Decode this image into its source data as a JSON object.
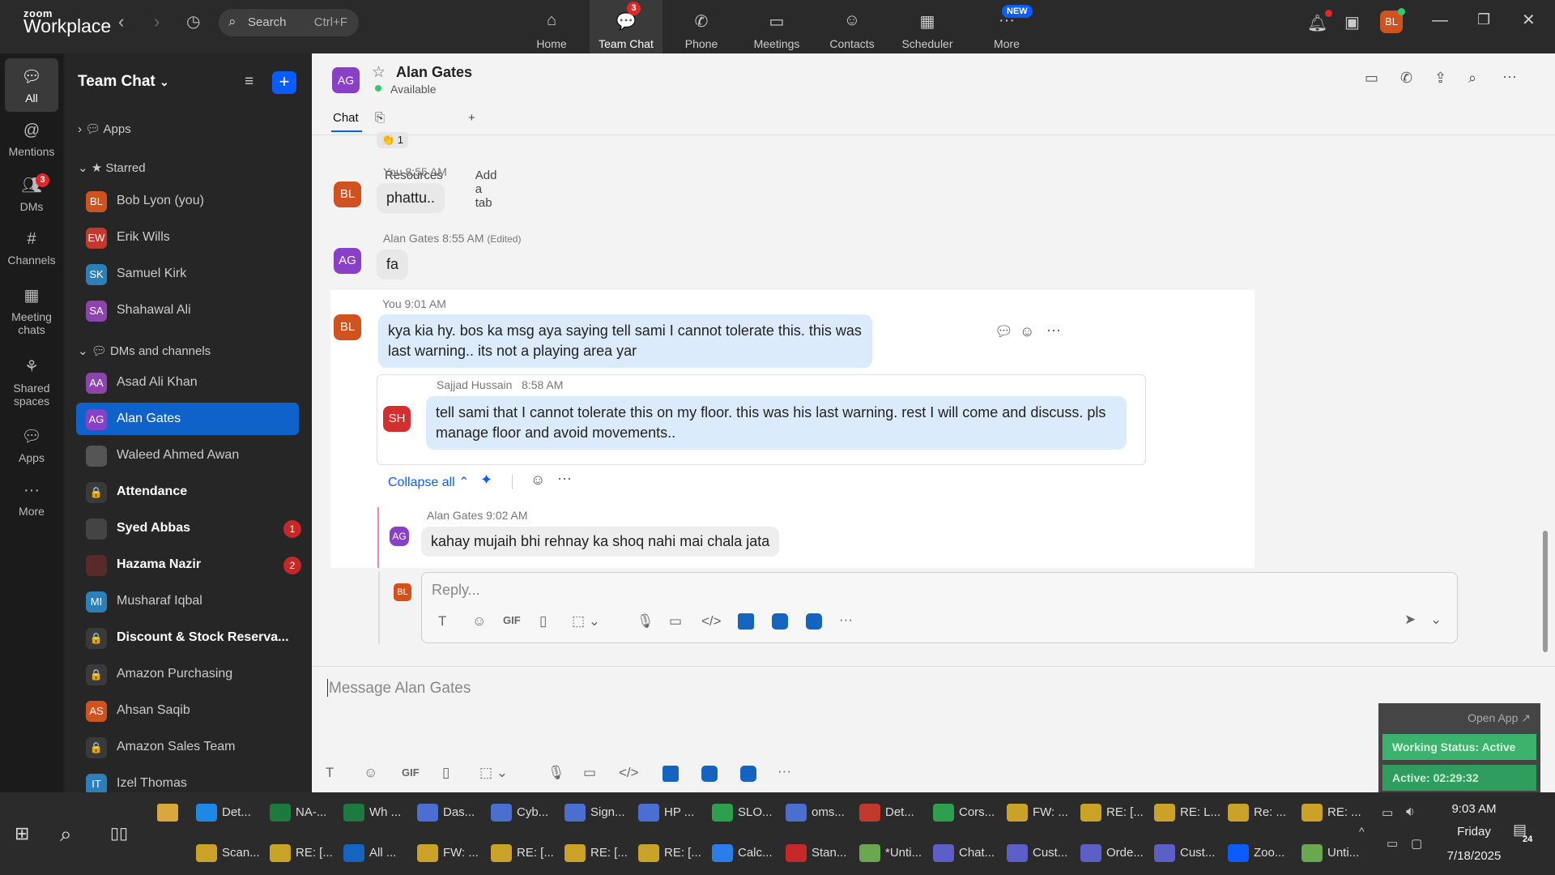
{
  "app": {
    "brand_top": "zoom",
    "brand_bottom": "Workplace"
  },
  "search": {
    "label": "Search",
    "shortcut": "Ctrl+F"
  },
  "top_nav": [
    {
      "label": "Home",
      "icon": "home-icon"
    },
    {
      "label": "Team Chat",
      "icon": "chat-icon",
      "badge": "3"
    },
    {
      "label": "Phone",
      "icon": "phone-icon"
    },
    {
      "label": "Meetings",
      "icon": "video-icon"
    },
    {
      "label": "Contacts",
      "icon": "contacts-icon"
    },
    {
      "label": "Scheduler",
      "icon": "calendar-icon"
    },
    {
      "label": "More",
      "icon": "more-icon",
      "new_badge": "NEW"
    }
  ],
  "user_avatar": "BL",
  "rail": [
    {
      "label": "All"
    },
    {
      "label": "Mentions"
    },
    {
      "label": "DMs",
      "badge": "3"
    },
    {
      "label": "Channels"
    },
    {
      "label": "Meeting chats"
    },
    {
      "label": "Shared spaces"
    },
    {
      "label": "Apps"
    },
    {
      "label": "More"
    }
  ],
  "sidebar": {
    "title": "Team Chat",
    "sections": {
      "apps": "Apps",
      "starred": "Starred",
      "dms": "DMs and channels"
    },
    "starred": [
      {
        "initials": "BL",
        "name": "Bob Lyon (you)",
        "color": "#d0531f"
      },
      {
        "initials": "EW",
        "name": "Erik Wills",
        "color": "#c0392b"
      },
      {
        "initials": "SK",
        "name": "Samuel Kirk",
        "color": "#2c7fb8"
      },
      {
        "initials": "SA",
        "name": "Shahawal Ali",
        "color": "#8e44ad"
      }
    ],
    "dms": [
      {
        "initials": "AA",
        "name": "Asad Ali Khan",
        "color": "#8e44ad",
        "bold": false
      },
      {
        "initials": "AG",
        "name": "Alan Gates",
        "color": "#8a3fc7",
        "bold": false,
        "active": true
      },
      {
        "initials": "",
        "name": "Waleed Ahmed Awan",
        "color": "#555555",
        "bold": false
      },
      {
        "initials": "🔒",
        "name": "Attendance",
        "color": "#3a3a3a",
        "bold": true
      },
      {
        "initials": "",
        "name": "Syed Abbas",
        "color": "#444444",
        "bold": true,
        "count": "1"
      },
      {
        "initials": "",
        "name": "Hazama Nazir",
        "color": "#5a2a2a",
        "bold": true,
        "count": "2"
      },
      {
        "initials": "MI",
        "name": "Musharaf Iqbal",
        "color": "#2c7fb8",
        "bold": false
      },
      {
        "initials": "🔒",
        "name": "Discount & Stock Reserva...",
        "color": "#3a3a3a",
        "bold": true
      },
      {
        "initials": "🔒",
        "name": "Amazon Purchasing",
        "color": "#3a3a3a",
        "bold": false
      },
      {
        "initials": "AS",
        "name": "Ahsan Saqib",
        "color": "#d0531f",
        "bold": false
      },
      {
        "initials": "🔒",
        "name": "Amazon Sales Team",
        "color": "#3a3a3a",
        "bold": false
      },
      {
        "initials": "IT",
        "name": "Izel Thomas",
        "color": "#2c7fb8",
        "bold": false
      }
    ]
  },
  "chat": {
    "contact_initials": "AG",
    "contact_name": "Alan Gates",
    "contact_status": "Available",
    "tabs": [
      "Chat",
      "Resources",
      "Add a tab"
    ],
    "reaction": "👏 1",
    "messages": [
      {
        "initials": "BL",
        "sender": "You",
        "time": "8:55 AM",
        "text": "phattu.."
      },
      {
        "initials": "AG",
        "sender": "Alan Gates",
        "time": "8:55 AM",
        "edited": "(Edited)",
        "text": "fa"
      },
      {
        "initials": "BL",
        "sender": "You",
        "time": "9:01 AM",
        "text": "kya kia hy. bos ka msg aya saying tell sami I cannot tolerate this. this was last warning.. its not a playing area yar"
      }
    ],
    "quoted": {
      "initials": "SH",
      "sender": "Sajjad Hussain",
      "time": "8:58 AM",
      "text": "tell sami that I cannot tolerate this on my floor. this was his last warning. rest I will come and discuss. pls manage floor and avoid movements.."
    },
    "collapse_label": "Collapse all",
    "thread_reply": {
      "initials": "AG",
      "sender": "Alan Gates",
      "time": "9:02 AM",
      "text": "kahay mujaih bhi rehnay ka shoq nahi mai chala jata"
    },
    "reply_initials": "BL",
    "reply_placeholder": "Reply...",
    "message_placeholder": "Message Alan Gates",
    "gif_label": "GIF"
  },
  "widget": {
    "open_app": "Open App ↗",
    "status": "Working Status: Active",
    "active": "Active: 02:29:32"
  },
  "taskbar": {
    "row1": [
      {
        "label": "Det...",
        "color": "#1e88e5"
      },
      {
        "label": "NA-...",
        "color": "#1d7a3e"
      },
      {
        "label": "Wh ...",
        "color": "#1d7a3e"
      },
      {
        "label": "Das...",
        "color": "#4a6fd0"
      },
      {
        "label": "Cyb...",
        "color": "#4a6fd0"
      },
      {
        "label": "Sign...",
        "color": "#4a6fd0"
      },
      {
        "label": "HP ...",
        "color": "#4a6fd0"
      },
      {
        "label": "SLO...",
        "color": "#2e9e4f"
      },
      {
        "label": "oms...",
        "color": "#4a6fd0"
      },
      {
        "label": "Det...",
        "color": "#c0392b"
      },
      {
        "label": "Cors...",
        "color": "#2e9e4f"
      },
      {
        "label": "FW: ...",
        "color": "#c9a227"
      },
      {
        "label": "RE: [...",
        "color": "#c9a227"
      },
      {
        "label": "RE: L...",
        "color": "#c9a227"
      },
      {
        "label": "Re: ...",
        "color": "#c9a227"
      },
      {
        "label": "RE: ...",
        "color": "#c9a227"
      }
    ],
    "row2": [
      {
        "label": "Scan...",
        "color": "#c9a227"
      },
      {
        "label": "RE: [...",
        "color": "#c9a227"
      },
      {
        "label": "All ...",
        "color": "#1565c0"
      },
      {
        "label": "FW: ...",
        "color": "#c9a227"
      },
      {
        "label": "RE: [...",
        "color": "#c9a227"
      },
      {
        "label": "RE: [...",
        "color": "#c9a227"
      },
      {
        "label": "RE: [...",
        "color": "#c9a227"
      },
      {
        "label": "Calc...",
        "color": "#2b7de9"
      },
      {
        "label": "Stan...",
        "color": "#c62828"
      },
      {
        "label": "*Unti...",
        "color": "#6aa84f"
      },
      {
        "label": "Chat...",
        "color": "#5b5fc7"
      },
      {
        "label": "Cust...",
        "color": "#5b5fc7"
      },
      {
        "label": "Orde...",
        "color": "#5b5fc7"
      },
      {
        "label": "Cust...",
        "color": "#5b5fc7"
      },
      {
        "label": "Zoo...",
        "color": "#0b5cff"
      },
      {
        "label": "Unti...",
        "color": "#6aa84f"
      }
    ],
    "time": "9:03 AM",
    "day": "Friday",
    "date": "7/18/2025",
    "notif_count": "24"
  }
}
